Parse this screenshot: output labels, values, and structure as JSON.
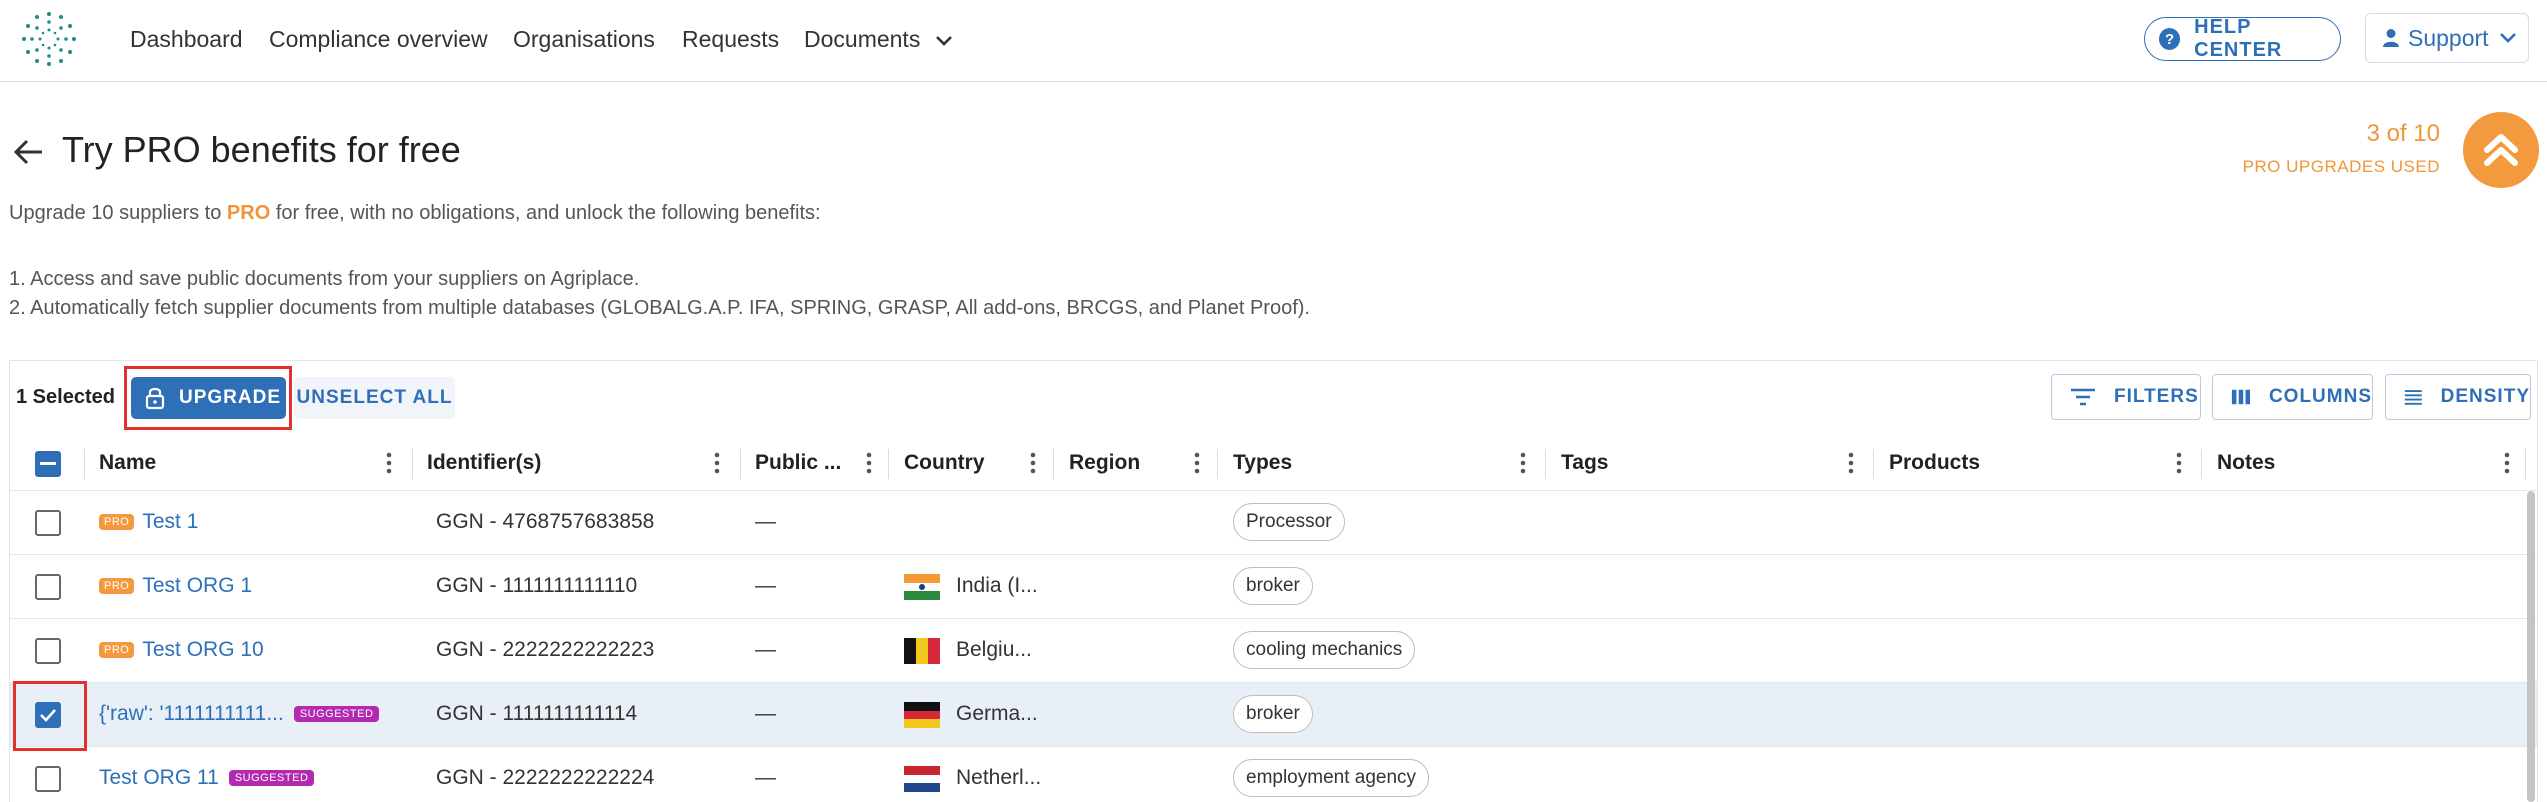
{
  "nav": {
    "items": [
      "Dashboard",
      "Compliance overview",
      "Organisations",
      "Requests",
      "Documents"
    ],
    "help_center": "HELP CENTER",
    "support": "Support"
  },
  "header": {
    "title": "Try PRO benefits for free",
    "upgrades_count": "3 of 10",
    "upgrades_label": "PRO UPGRADES USED",
    "intro_before": "Upgrade 10 suppliers to ",
    "intro_pro": "PRO",
    "intro_after": " for free, with no obligations, and unlock the following benefits:",
    "benefits": [
      "1. Access and save public documents from your suppliers on Agriplace.",
      "2. Automatically fetch supplier documents from multiple databases (GLOBALG.A.P. IFA, SPRING, GRASP, All add-ons, BRCGS, and Planet Proof)."
    ]
  },
  "toolbar": {
    "selected": "1 Selected",
    "upgrade": "UPGRADE",
    "unselect_all": "UNSELECT ALL",
    "filters": "FILTERS",
    "columns": "COLUMNS",
    "density": "DENSITY"
  },
  "table": {
    "columns": [
      "Name",
      "Identifier(s)",
      "Public ...",
      "Country",
      "Region",
      "Types",
      "Tags",
      "Products",
      "Notes"
    ],
    "badges": {
      "pro": "PRO",
      "suggested": "SUGGESTED"
    },
    "rows": [
      {
        "name": "Test 1",
        "badge": "pro",
        "identifier": "GGN - 4768757683858",
        "public": "—",
        "country": "",
        "flag": "",
        "type": "Processor",
        "checked": false
      },
      {
        "name": "Test ORG 1",
        "badge": "pro",
        "identifier": "GGN - 1111111111110",
        "public": "—",
        "country": "India (I...",
        "flag": "india",
        "type": "broker",
        "checked": false
      },
      {
        "name": "Test ORG 10",
        "badge": "pro",
        "identifier": "GGN - 2222222222223",
        "public": "—",
        "country": "Belgiu...",
        "flag": "belgium",
        "type": "cooling mechanics",
        "checked": false
      },
      {
        "name": "{'raw': '1111111111...",
        "badge": "suggested",
        "identifier": "GGN - 1111111111114",
        "public": "—",
        "country": "Germa...",
        "flag": "germany",
        "type": "broker",
        "checked": true
      },
      {
        "name": "Test ORG 11",
        "badge": "suggested",
        "identifier": "GGN - 2222222222224",
        "public": "—",
        "country": "Netherl...",
        "flag": "netherlands",
        "type": "employment agency",
        "checked": false
      }
    ]
  },
  "colors": {
    "primary": "#2f6fb8",
    "pro_orange": "#f39a3e",
    "suggested_purple": "#b32ab1",
    "highlight_red": "#e03030",
    "selected_row": "#e9eff7"
  },
  "icons": [
    "logo-icon",
    "chevron-down-icon",
    "help-icon",
    "user-icon",
    "back-arrow-icon",
    "double-chevron-up-icon",
    "lock-icon",
    "filter-icon",
    "columns-icon",
    "density-icon",
    "column-menu-icon",
    "checkmark-icon"
  ]
}
